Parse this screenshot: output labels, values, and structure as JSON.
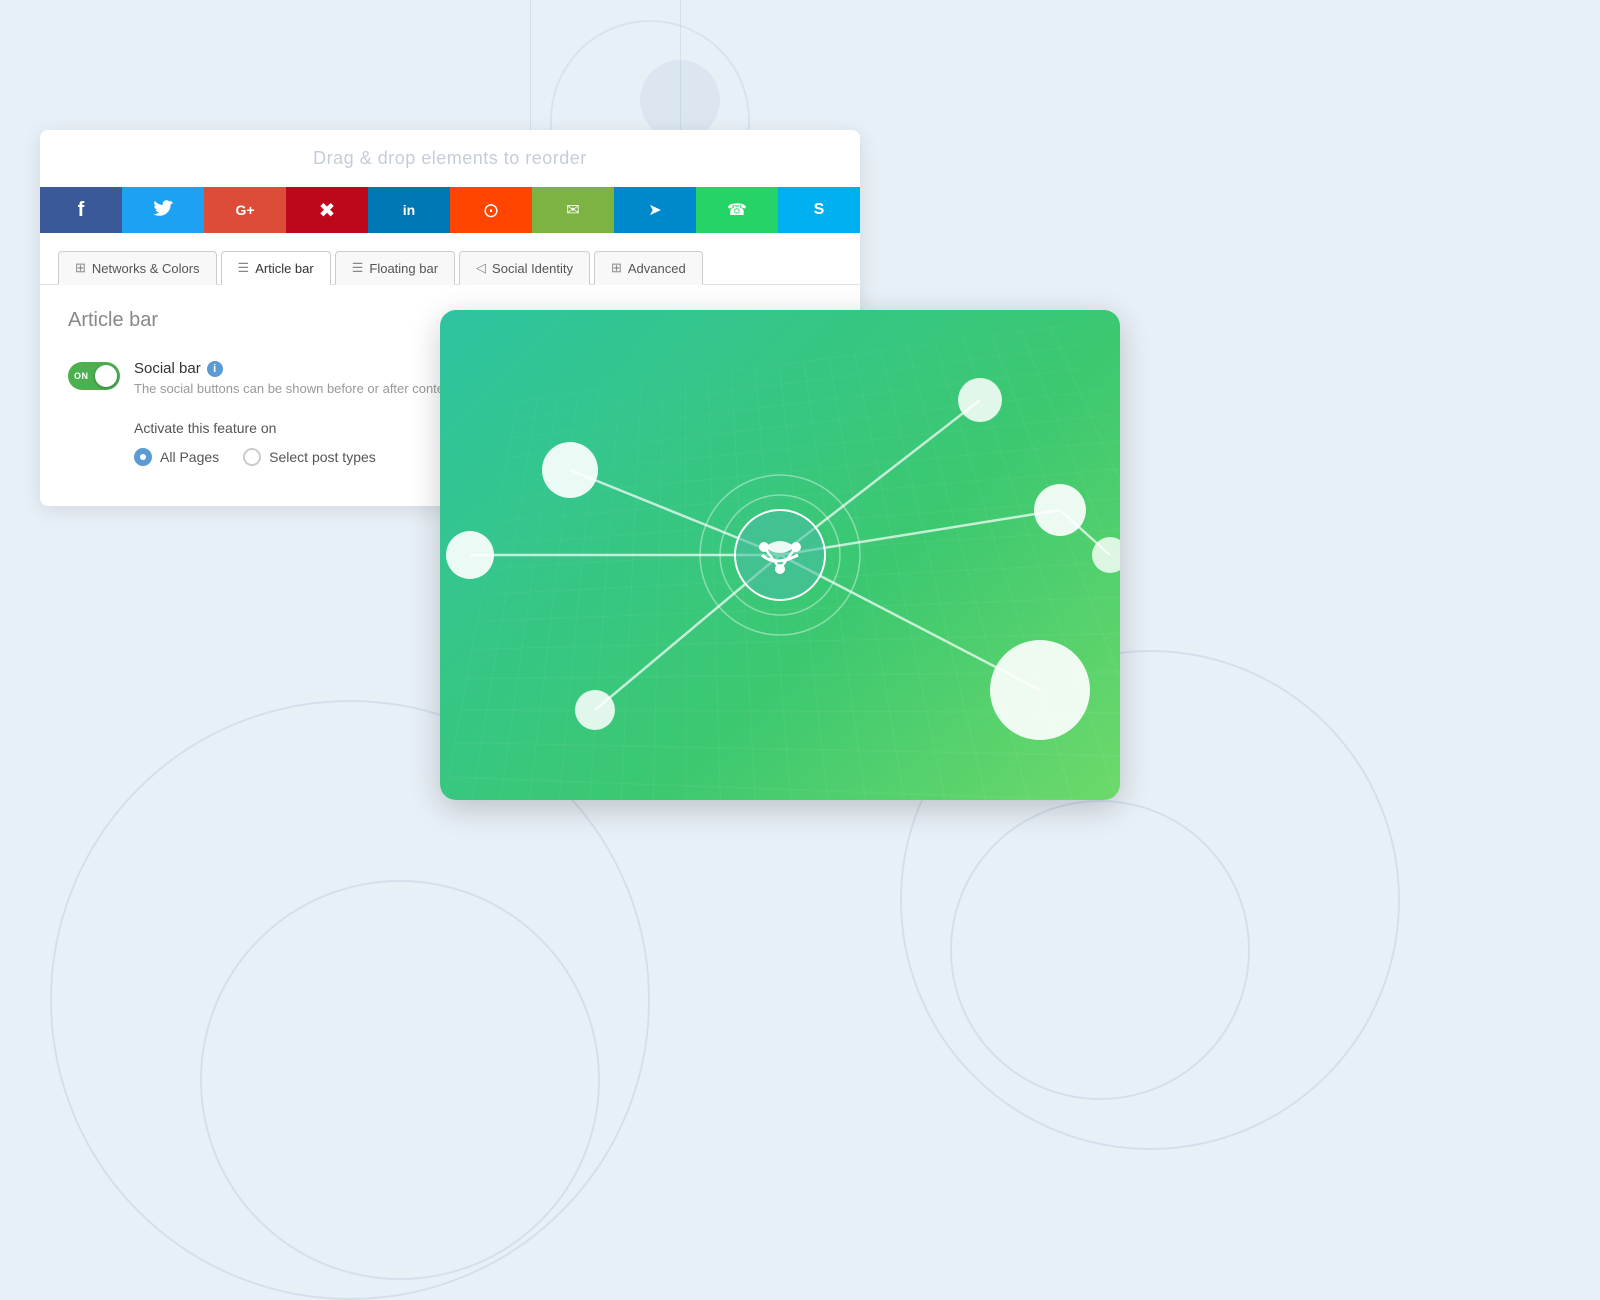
{
  "page": {
    "background_color": "#e8f0f7"
  },
  "drag_header": {
    "text": "Drag & drop elements to reorder"
  },
  "social_buttons": [
    {
      "id": "facebook",
      "icon": "f",
      "color": "#3b5998"
    },
    {
      "id": "twitter",
      "icon": "🐦",
      "color": "#1da1f2"
    },
    {
      "id": "google-plus",
      "icon": "G+",
      "color": "#dd4b39",
      "font_size": "14px"
    },
    {
      "id": "pinterest",
      "icon": "⊕",
      "color": "#bd081c"
    },
    {
      "id": "linkedin",
      "icon": "in",
      "color": "#0077b5",
      "font_size": "14px"
    },
    {
      "id": "reddit",
      "icon": "●",
      "color": "#ff4500"
    },
    {
      "id": "email",
      "icon": "✉",
      "color": "#7cb342"
    },
    {
      "id": "telegram",
      "icon": "▷",
      "color": "#0088cc"
    },
    {
      "id": "whatsapp",
      "icon": "📱",
      "color": "#25d366"
    },
    {
      "id": "skype",
      "icon": "S",
      "color": "#00aff0"
    }
  ],
  "tabs": [
    {
      "id": "networks-colors",
      "label": "Networks & Colors",
      "icon": "⊞",
      "active": false
    },
    {
      "id": "article-bar",
      "label": "Article bar",
      "icon": "☰",
      "active": true
    },
    {
      "id": "floating-bar",
      "label": "Floating bar",
      "icon": "☰",
      "active": false
    },
    {
      "id": "social-identity",
      "label": "Social Identity",
      "icon": "◁",
      "active": false
    },
    {
      "id": "advanced",
      "label": "Advanced",
      "icon": "⊞",
      "active": false
    }
  ],
  "content": {
    "section_title": "Article bar",
    "social_bar": {
      "label": "Social bar",
      "info": "i",
      "description": "The social buttons can be shown before or after content (post, page, custo",
      "toggle_on": true,
      "toggle_label": "ON"
    },
    "activate": {
      "title": "Activate this feature on",
      "options": [
        {
          "id": "all-pages",
          "label": "All Pages",
          "selected": true
        },
        {
          "id": "select-post-types",
          "label": "Select post types",
          "selected": false
        }
      ]
    }
  }
}
